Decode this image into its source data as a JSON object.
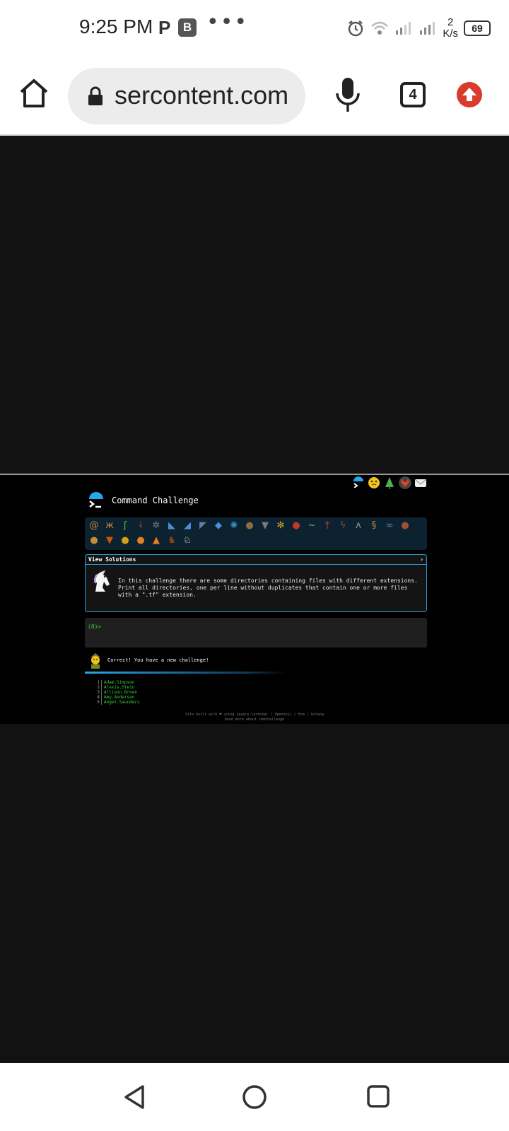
{
  "status": {
    "time": "9:25 PM",
    "p_label": "P",
    "b_label": "B",
    "dots": "•••",
    "net_value": "2",
    "net_unit": "K/s",
    "battery": "69"
  },
  "browser": {
    "url": "sercontent.com",
    "tab_count": "4"
  },
  "page": {
    "title": "Command Challenge",
    "solutions_label": "View Solutions",
    "solutions_chevron": "›",
    "task_text": "In this challenge there are some directories containing files with different extensions. Print all directories, one per line without duplicates that contain one or more files with a \".tf\" extension.",
    "prompt": "(0)>",
    "result_message": "Correct! You have a new challenge!",
    "output_rows": [
      {
        "n": "1",
        "v": "Adam.Simpson"
      },
      {
        "n": "2",
        "v": "Alexis.Stein"
      },
      {
        "n": "3",
        "v": "Allison.Brown"
      },
      {
        "n": "4",
        "v": "Amy.Anderson"
      },
      {
        "n": "5",
        "v": "Angel.Saunders"
      }
    ],
    "footer_line1": "Site built with ♥ using jquery.terminal / Opennoji / Hcm / Golang",
    "footer_line2": "Read more about cmdchallenge"
  },
  "colors": {
    "accent": "#2d9bd6",
    "terminal_green": "#3ecf3e",
    "update_red": "#d93c2c"
  }
}
